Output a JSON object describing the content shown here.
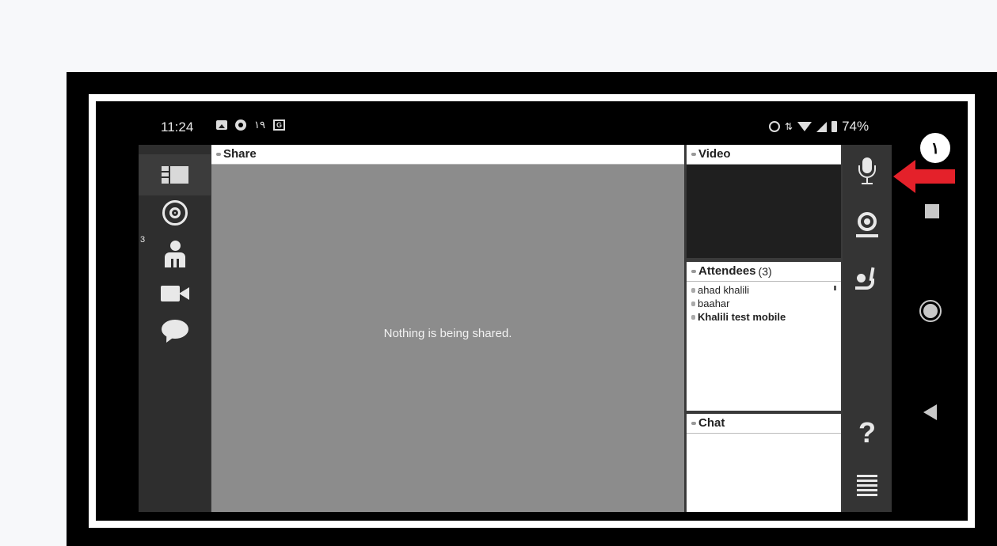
{
  "status_bar": {
    "time": "11:24",
    "notification": "۱۹",
    "translate_glyph": "G",
    "battery": "74%"
  },
  "left_rail": {
    "attendee_count_badge": "3",
    "items": [
      {
        "icon": "layout-icon"
      },
      {
        "icon": "broadcast-icon"
      },
      {
        "icon": "attendees-icon"
      },
      {
        "icon": "camera-icon"
      },
      {
        "icon": "chat-bubble-icon"
      }
    ]
  },
  "share_pod": {
    "title": "Share",
    "message": "Nothing is being shared."
  },
  "video_pod": {
    "title": "Video"
  },
  "attendees_pod": {
    "title": "Attendees",
    "count": "(3)",
    "attendees": [
      {
        "name": "ahad khalili",
        "bold": false
      },
      {
        "name": "baahar",
        "bold": false
      },
      {
        "name": "Khalili test mobile",
        "bold": true
      }
    ]
  },
  "chat_pod": {
    "title": "Chat"
  },
  "right_rail": {
    "items": [
      "microphone-icon",
      "webcam-icon",
      "raise-hand-icon",
      "help-icon",
      "menu-icon"
    ],
    "help_glyph": "?"
  },
  "annotation": {
    "step_number": "۱",
    "arrow_color": "#e4212a"
  }
}
